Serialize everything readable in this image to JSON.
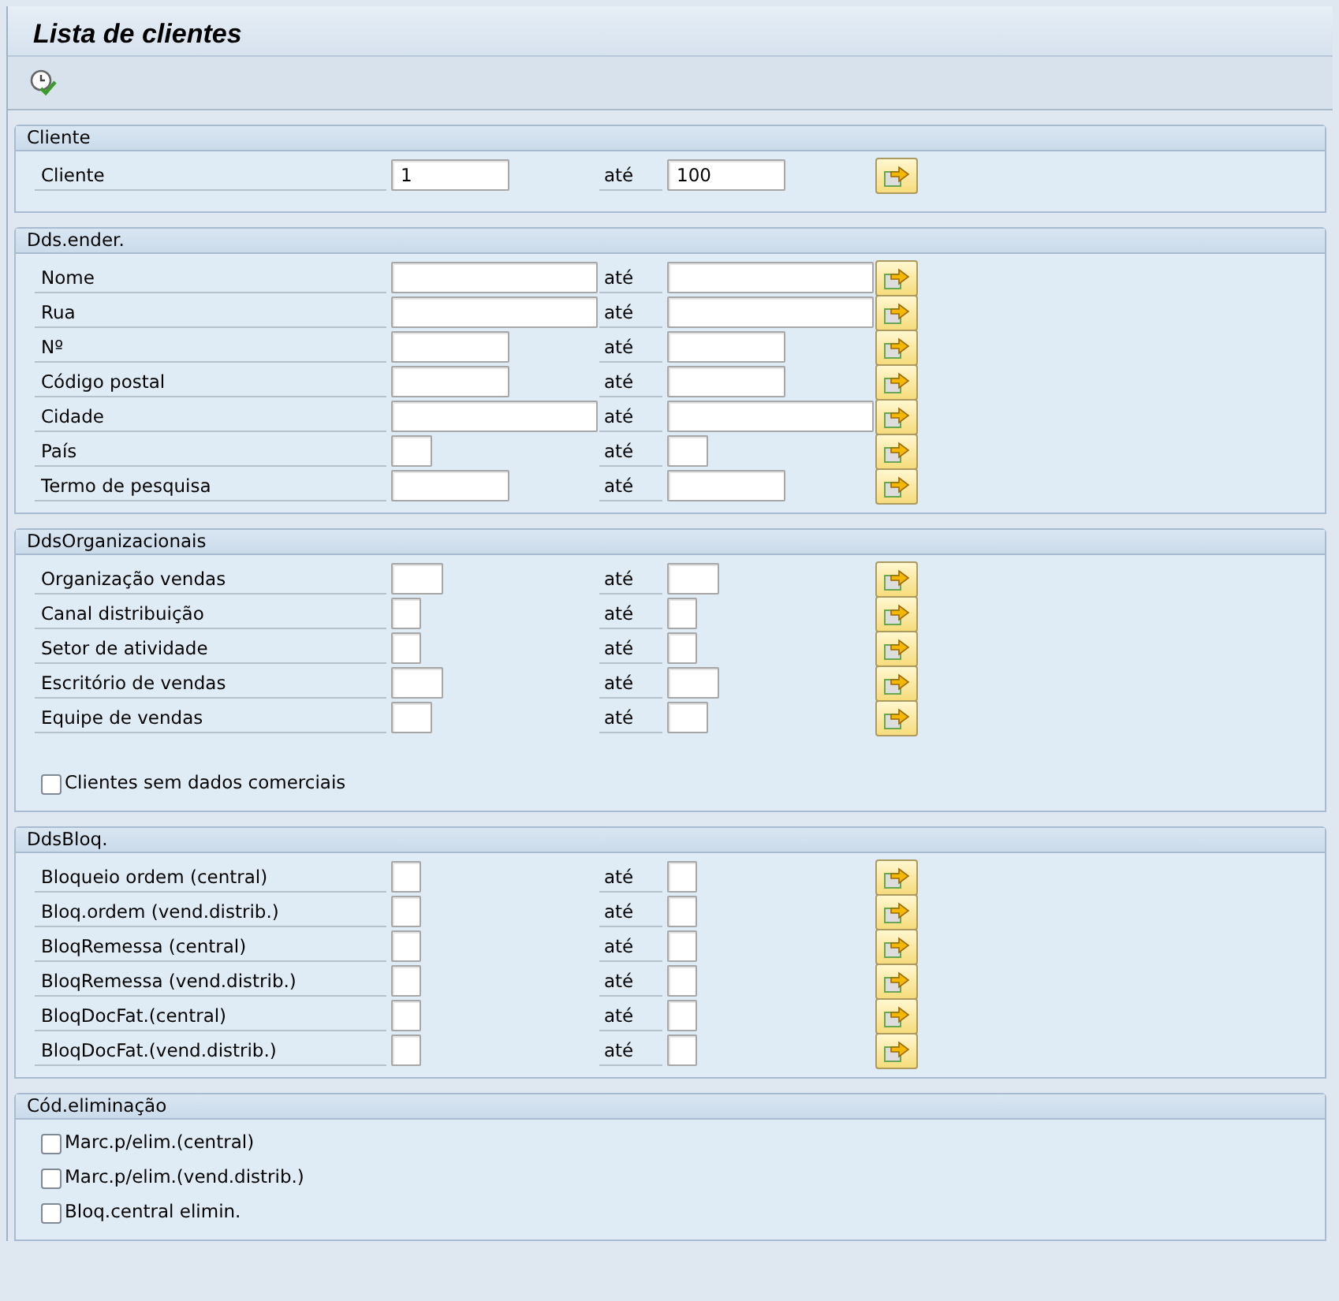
{
  "window": {
    "title": "Lista de clientes"
  },
  "groups": [
    {
      "title": "Cliente",
      "rows": [
        {
          "label": "Cliente",
          "from": "1",
          "to_label": "até",
          "to": "100"
        }
      ]
    },
    {
      "title": "Dds.ender.",
      "rows": [
        {
          "label": "Nome",
          "to_label": "até"
        },
        {
          "label": "Rua",
          "to_label": "até"
        },
        {
          "label": "Nº",
          "to_label": "até"
        },
        {
          "label": "Código postal",
          "to_label": "até"
        },
        {
          "label": "Cidade",
          "to_label": "até"
        },
        {
          "label": "País",
          "to_label": "até"
        },
        {
          "label": "Termo de pesquisa",
          "to_label": "até"
        }
      ]
    },
    {
      "title": "DdsOrganizacionais",
      "rows": [
        {
          "label": "Organização vendas",
          "to_label": "até"
        },
        {
          "label": "Canal distribuição",
          "to_label": "até"
        },
        {
          "label": "Setor de atividade",
          "to_label": "até"
        },
        {
          "label": "Escritório de vendas",
          "to_label": "até"
        },
        {
          "label": "Equipe de vendas",
          "to_label": "até"
        }
      ],
      "checkboxes": [
        {
          "label": "Clientes sem dados comerciais",
          "checked": false
        }
      ]
    },
    {
      "title": "DdsBloq.",
      "rows": [
        {
          "label": "Bloqueio ordem (central)",
          "to_label": "até"
        },
        {
          "label": "Bloq.ordem (vend.distrib.)",
          "to_label": "até"
        },
        {
          "label": "BloqRemessa (central)",
          "to_label": "até"
        },
        {
          "label": "BloqRemessa (vend.distrib.)",
          "to_label": "até"
        },
        {
          "label": "BloqDocFat.(central)",
          "to_label": "até"
        },
        {
          "label": "BloqDocFat.(vend.distrib.)",
          "to_label": "até"
        }
      ]
    },
    {
      "title": "Cód.eliminação",
      "checkboxes": [
        {
          "label": "Marc.p/elim.(central)",
          "checked": false
        },
        {
          "label": "Marc.p/elim.(vend.distrib.)",
          "checked": false
        },
        {
          "label": "Bloq.central elimin.",
          "checked": false
        }
      ]
    }
  ]
}
